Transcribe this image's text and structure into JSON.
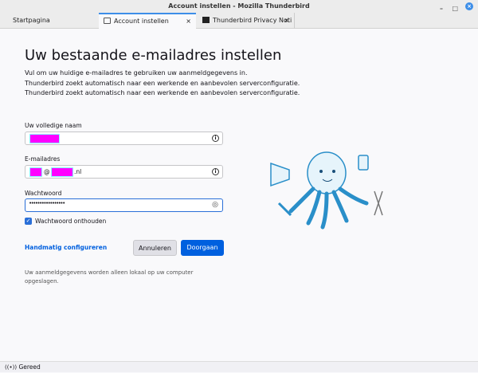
{
  "window": {
    "title": "Account instellen - Mozilla Thunderbird",
    "minimize": "–",
    "maximize": "□",
    "close": "×"
  },
  "tabs": [
    {
      "label": "Startpagina"
    },
    {
      "label": "Account instellen",
      "close": "×"
    },
    {
      "label": "Thunderbird Privacy Noti",
      "close": "×"
    }
  ],
  "main": {
    "title": "Uw bestaande e-mailadres instellen",
    "intro": [
      "Vul om uw huidige e-mailadres te gebruiken uw aanmeldgegevens in.",
      "Thunderbird zoekt automatisch naar een werkende en aanbevolen serverconfiguratie.",
      "Thunderbird zoekt automatisch naar een werkende en aanbevolen serverconfiguratie."
    ],
    "name_label": "Uw volledige naam",
    "email_label": "E-mailadres",
    "email_at": "@",
    "email_suffix": ".nl",
    "password_label": "Wachtwoord",
    "password_value": "•••••••••••••••••",
    "remember_label": "Wachtwoord onthouden",
    "remember_checked": true,
    "manual_link": "Handmatig configureren",
    "cancel": "Annuleren",
    "continue": "Doorgaan",
    "footnote": "Uw aanmeldgegevens worden alleen lokaal op uw computer opgeslagen."
  },
  "status": {
    "text": "Gereed"
  },
  "colors": {
    "accent": "#0060df",
    "redaction": "#ff00ff"
  }
}
